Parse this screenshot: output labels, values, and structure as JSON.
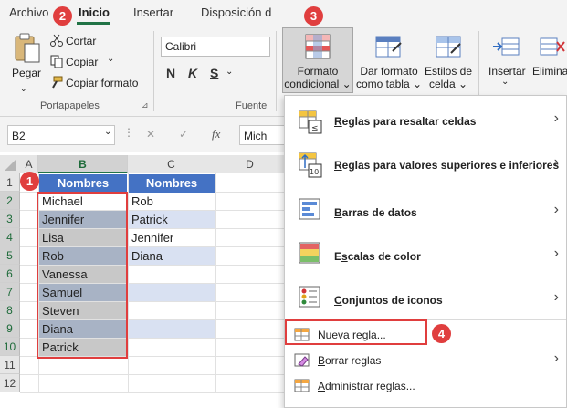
{
  "tabs": {
    "archivo": "Archivo",
    "inicio": "Inicio",
    "insertar": "Insertar",
    "disposicion": "Disposición d"
  },
  "ribbon": {
    "pegar": "Pegar",
    "cortar": "Cortar",
    "copiar": "Copiar",
    "copiar_formato": "Copiar formato",
    "portapapeles": "Portapapeles",
    "font_name": "Calibri",
    "bold": "N",
    "italic": "K",
    "underline": "S",
    "fuente": "Fuente",
    "formato_condicional_1": "Formato",
    "formato_condicional_2": "condicional",
    "dar_formato_1": "Dar formato",
    "dar_formato_2": "como tabla",
    "estilos_1": "Estilos de",
    "estilos_2": "celda",
    "insertar": "Insertar",
    "eliminar": "Eliminar"
  },
  "formula_bar": {
    "name_box": "B2",
    "cancel": "✕",
    "confirm": "✓",
    "fx": "fx",
    "content": "Mich"
  },
  "columns": [
    "A",
    "B",
    "C",
    "D"
  ],
  "rows": [
    "1",
    "2",
    "3",
    "4",
    "5",
    "6",
    "7",
    "8",
    "9",
    "10",
    "11",
    "12"
  ],
  "sheet": {
    "header_b": "Nombres",
    "header_c": "Nombres",
    "col_b": [
      "Michael",
      "Jennifer",
      "Lisa",
      "Rob",
      "Vanessa",
      "Samuel",
      "Steven",
      "Diana",
      "Patrick"
    ],
    "col_c": [
      "Rob",
      "Patrick",
      "Jennifer",
      "Diana",
      "",
      "",
      "",
      "",
      ""
    ]
  },
  "menu": {
    "resaltar": "Reglas para resaltar celdas",
    "superiores": "Reglas para valores superiores e inferiores",
    "barras": "Barras de datos",
    "escalas": "Escalas de color",
    "conjuntos": "Conjuntos de iconos",
    "nueva": "Nueva regla...",
    "borrar": "Borrar reglas",
    "administrar": "Administrar reglas..."
  },
  "callouts": {
    "c1": "1",
    "c2": "2",
    "c3": "3",
    "c4": "4"
  },
  "colors": {
    "accent_green": "#217346",
    "header_blue": "#4472c4",
    "callout_red": "#e03e3e"
  }
}
